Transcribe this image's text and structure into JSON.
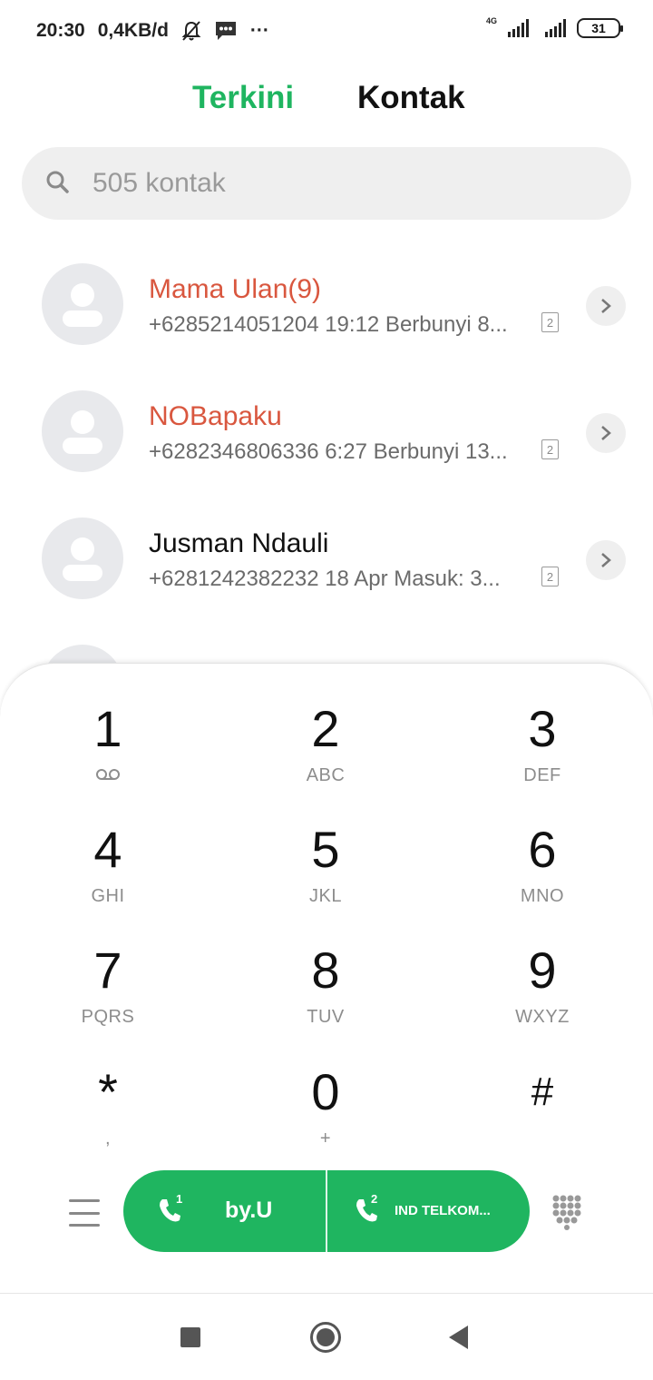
{
  "status_bar": {
    "time": "20:30",
    "net_speed": "0,4KB/d",
    "more": "···",
    "network_type": "4G",
    "battery": "31"
  },
  "tabs": [
    {
      "label": "Terkini",
      "active": true
    },
    {
      "label": "Kontak",
      "active": false
    }
  ],
  "search": {
    "placeholder": "505 kontak"
  },
  "calls": [
    {
      "name": "Mama Ulan(9)",
      "missed": true,
      "detail": "+6285214051204  19:12 Berbunyi 8...",
      "sim": "2"
    },
    {
      "name": "NOBapaku",
      "missed": true,
      "detail": "+6282346806336  6:27 Berbunyi 13...",
      "sim": "2"
    },
    {
      "name": "Jusman Ndauli",
      "missed": false,
      "detail": "+6281242382232  18 Apr Masuk: 3...",
      "sim": "2"
    }
  ],
  "dialpad": {
    "keys": [
      {
        "digit": "1",
        "letters": ""
      },
      {
        "digit": "2",
        "letters": "ABC"
      },
      {
        "digit": "3",
        "letters": "DEF"
      },
      {
        "digit": "4",
        "letters": "GHI"
      },
      {
        "digit": "5",
        "letters": "JKL"
      },
      {
        "digit": "6",
        "letters": "MNO"
      },
      {
        "digit": "7",
        "letters": "PQRS"
      },
      {
        "digit": "8",
        "letters": "TUV"
      },
      {
        "digit": "9",
        "letters": "WXYZ"
      },
      {
        "digit": "*",
        "letters": ","
      },
      {
        "digit": "0",
        "letters": "+"
      },
      {
        "digit": "#",
        "letters": ""
      }
    ]
  },
  "call_buttons": {
    "sim1_number": "1",
    "sim1_carrier": "by.U",
    "sim2_number": "2",
    "sim2_carrier": "IND TELKOM..."
  },
  "colors": {
    "accent": "#1fb560",
    "missed": "#d9573f"
  },
  "icons": {
    "status": [
      "mute-bell-icon",
      "message-icon",
      "signal-icon",
      "battery-icon"
    ],
    "nav": [
      "recents-square-icon",
      "home-circle-icon",
      "back-triangle-icon"
    ]
  }
}
